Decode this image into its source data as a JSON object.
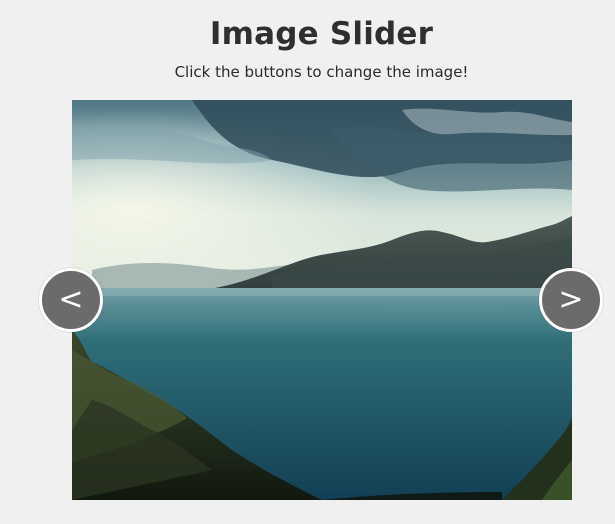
{
  "header": {
    "title": "Image Slider",
    "subtitle": "Click the buttons to change the image!"
  },
  "slider": {
    "prev_label": "<",
    "next_label": ">",
    "image_subject": "mountain lake landscape"
  },
  "colors": {
    "background": "#f0f0f0",
    "button": "#6b6b6b",
    "button_border": "#ffffff"
  }
}
